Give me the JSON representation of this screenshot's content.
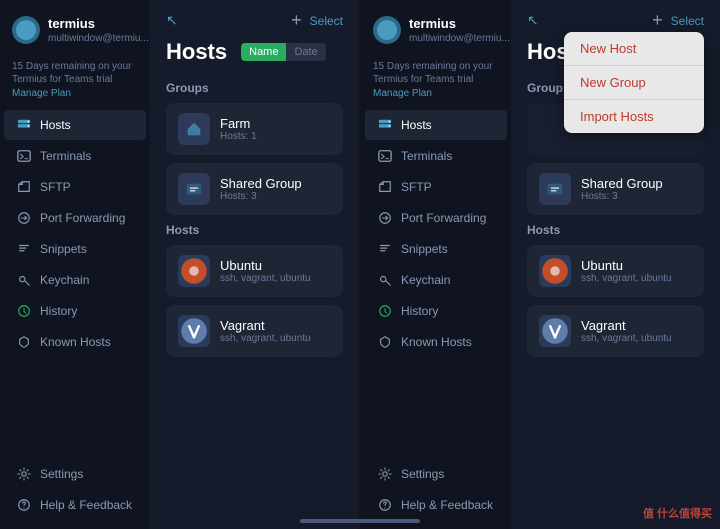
{
  "left": {
    "sidebar": {
      "account": {
        "name": "termius",
        "email": "multiwindow@termiu..."
      },
      "trial": {
        "text": "15 Days remaining on your Termius for Teams trial",
        "manage_label": "Manage Plan"
      },
      "nav_items": [
        {
          "id": "hosts",
          "label": "Hosts",
          "icon": "server",
          "active": true
        },
        {
          "id": "terminals",
          "label": "Terminals",
          "icon": "terminal",
          "active": false
        },
        {
          "id": "sftp",
          "label": "SFTP",
          "icon": "folder",
          "active": false
        },
        {
          "id": "port-forwarding",
          "label": "Port Forwarding",
          "icon": "port",
          "active": false
        },
        {
          "id": "snippets",
          "label": "Snippets",
          "icon": "snippet",
          "active": false
        },
        {
          "id": "keychain",
          "label": "Keychain",
          "icon": "key",
          "active": false
        },
        {
          "id": "history",
          "label": "History",
          "icon": "clock",
          "active": false
        },
        {
          "id": "known-hosts",
          "label": "Known Hosts",
          "icon": "shield",
          "active": false
        }
      ],
      "footer_items": [
        {
          "id": "settings",
          "label": "Settings",
          "icon": "gear"
        },
        {
          "id": "help",
          "label": "Help & Feedback",
          "icon": "question"
        }
      ]
    },
    "main": {
      "title": "Hosts",
      "sort": {
        "name": "Name",
        "date": "Date"
      },
      "groups_section": "Groups",
      "hosts_section": "Hosts",
      "groups": [
        {
          "id": "farm",
          "name": "Farm",
          "hosts_count": "Hosts: 1"
        },
        {
          "id": "shared-group",
          "name": "Shared Group",
          "hosts_count": "Hosts: 3"
        }
      ],
      "hosts": [
        {
          "id": "ubuntu",
          "name": "Ubuntu",
          "tags": "ssh, vagrant, ubuntu"
        },
        {
          "id": "vagrant",
          "name": "Vagrant",
          "tags": "ssh, vagrant, ubuntu"
        }
      ],
      "select_label": "Select",
      "plus_label": "+"
    }
  },
  "right": {
    "sidebar": {
      "account": {
        "name": "termius",
        "email": "multiwindow@termiu..."
      },
      "trial": {
        "text": "15 Days remaining on your Termius for Teams trial",
        "manage_label": "Manage Plan"
      },
      "nav_items": [
        {
          "id": "hosts",
          "label": "Hosts",
          "icon": "server",
          "active": true
        },
        {
          "id": "terminals",
          "label": "Terminals",
          "icon": "terminal",
          "active": false
        },
        {
          "id": "sftp",
          "label": "SFTP",
          "icon": "folder",
          "active": false
        },
        {
          "id": "port-forwarding",
          "label": "Port Forwarding",
          "icon": "port",
          "active": false
        },
        {
          "id": "snippets",
          "label": "Snippets",
          "icon": "snippet",
          "active": false
        },
        {
          "id": "keychain",
          "label": "Keychain",
          "icon": "key",
          "active": false
        },
        {
          "id": "history",
          "label": "History",
          "icon": "clock",
          "active": false
        },
        {
          "id": "known-hosts",
          "label": "Known Hosts",
          "icon": "shield",
          "active": false
        }
      ],
      "footer_items": [
        {
          "id": "settings",
          "label": "Settings",
          "icon": "gear"
        },
        {
          "id": "help",
          "label": "Help & Feedback",
          "icon": "question"
        }
      ]
    },
    "main": {
      "title": "Hos",
      "select_label": "Select",
      "groups_section": "Group",
      "hosts_section": "Hosts",
      "groups": [
        {
          "id": "shared-group",
          "name": "Shared Group",
          "hosts_count": "Hosts: 3"
        }
      ],
      "hosts": [
        {
          "id": "ubuntu",
          "name": "Ubuntu",
          "tags": "ssh, vagrant, ubuntu"
        },
        {
          "id": "vagrant",
          "name": "Vagrant",
          "tags": "ssh, vagrant, ubuntu"
        }
      ]
    },
    "dropdown": {
      "items": [
        {
          "id": "new-host",
          "label": "New Host"
        },
        {
          "id": "new-group",
          "label": "New Group"
        },
        {
          "id": "import-hosts",
          "label": "Import Hosts"
        }
      ]
    }
  },
  "watermark": "值 什么值得买"
}
